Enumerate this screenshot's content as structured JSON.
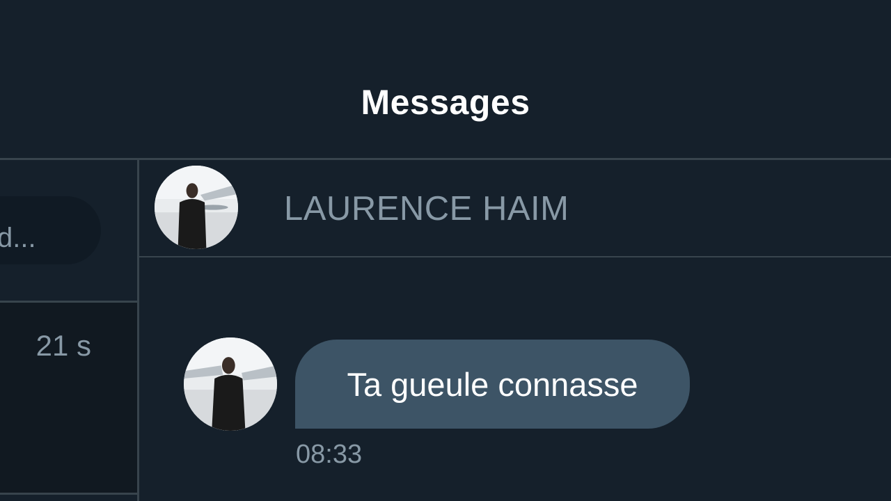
{
  "header": {
    "title": "Messages"
  },
  "sidebar": {
    "search_placeholder": "d...",
    "conversation": {
      "time": "21 s"
    }
  },
  "conversation": {
    "contact_name": "LAURENCE HAIM",
    "avatar_icon": "profile-photo"
  },
  "messages": [
    {
      "text": "Ta gueule connasse",
      "time": "08:33",
      "direction": "incoming"
    }
  ],
  "colors": {
    "background": "#15202b",
    "divider": "#38444d",
    "bubble": "#3d5466",
    "secondary_text": "#8899a6",
    "primary_text": "#ffffff"
  }
}
